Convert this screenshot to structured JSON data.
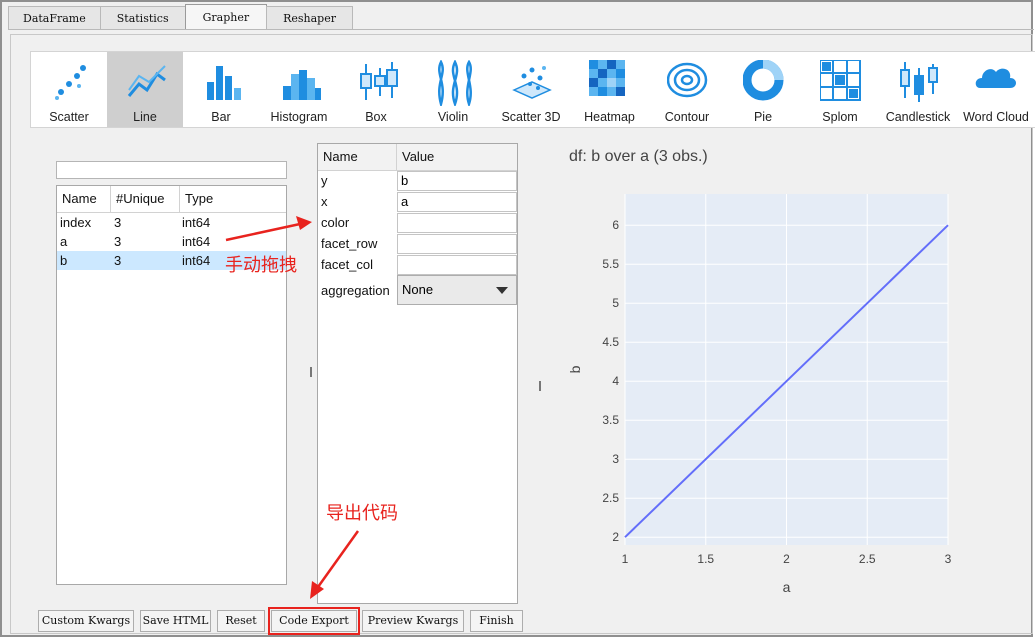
{
  "tabs": [
    {
      "label": "DataFrame"
    },
    {
      "label": "Statistics"
    },
    {
      "label": "Grapher",
      "active": true
    },
    {
      "label": "Reshaper"
    }
  ],
  "chart_types": [
    {
      "label": "Scatter",
      "icon": "scatter-icon"
    },
    {
      "label": "Line",
      "icon": "line-icon",
      "selected": true
    },
    {
      "label": "Bar",
      "icon": "bar-icon"
    },
    {
      "label": "Histogram",
      "icon": "histogram-icon"
    },
    {
      "label": "Box",
      "icon": "box-icon"
    },
    {
      "label": "Violin",
      "icon": "violin-icon"
    },
    {
      "label": "Scatter 3D",
      "icon": "scatter3d-icon"
    },
    {
      "label": "Heatmap",
      "icon": "heatmap-icon"
    },
    {
      "label": "Contour",
      "icon": "contour-icon"
    },
    {
      "label": "Pie",
      "icon": "pie-icon"
    },
    {
      "label": "Splom",
      "icon": "splom-icon"
    },
    {
      "label": "Candlestick",
      "icon": "candlestick-icon"
    },
    {
      "label": "Word Cloud",
      "icon": "wordcloud-icon"
    }
  ],
  "columns": {
    "headers": [
      "Name",
      "#Unique",
      "Type"
    ],
    "rows": [
      {
        "name": "index",
        "unique": "3",
        "type": "int64"
      },
      {
        "name": "a",
        "unique": "3",
        "type": "int64"
      },
      {
        "name": "b",
        "unique": "3",
        "type": "int64",
        "selected": true
      }
    ]
  },
  "kwargs": {
    "headers": [
      "Name",
      "Value"
    ],
    "rows": [
      {
        "name": "y",
        "value": "b"
      },
      {
        "name": "x",
        "value": "a"
      },
      {
        "name": "color",
        "value": ""
      },
      {
        "name": "facet_row",
        "value": ""
      },
      {
        "name": "facet_col",
        "value": ""
      }
    ],
    "aggregation": {
      "name": "aggregation",
      "value": "None"
    }
  },
  "buttons": [
    {
      "label": "Custom Kwargs"
    },
    {
      "label": "Save HTML"
    },
    {
      "label": "Reset"
    },
    {
      "label": "Code Export",
      "highlighted": true
    },
    {
      "label": "Preview Kwargs"
    },
    {
      "label": "Finish"
    }
  ],
  "annotations": {
    "drag": "手动拖拽",
    "export": "导出代码"
  },
  "colors": {
    "accent": "#636efa",
    "plot_bg": "#e5ecf6",
    "annotation": "#e8231e",
    "selection": "#cce8ff"
  },
  "chart_data": {
    "type": "line",
    "title": "df: b  over a (3 obs.)",
    "xlabel": "a",
    "ylabel": "b",
    "x": [
      1,
      2,
      3
    ],
    "y": [
      2,
      4,
      6
    ],
    "xlim": [
      1,
      3
    ],
    "ylim": [
      1.9,
      6.4
    ],
    "xticks": [
      "1",
      "1.5",
      "2",
      "2.5",
      "3"
    ],
    "yticks": [
      "2",
      "2.5",
      "3",
      "3.5",
      "4",
      "4.5",
      "5",
      "5.5",
      "6"
    ],
    "grid": true
  }
}
